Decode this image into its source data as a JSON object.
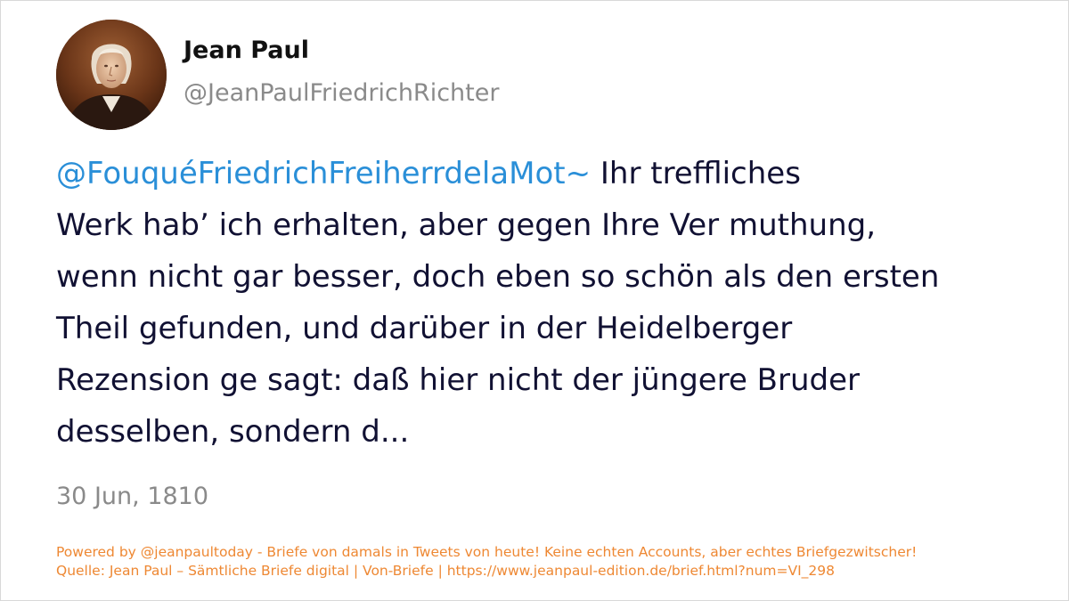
{
  "profile": {
    "display_name": "Jean Paul",
    "handle": "@JeanPaulFriedrichRichter",
    "avatar_icon": "portrait-avatar"
  },
  "tweet": {
    "mention": "@FouquéFriedrichFreiherrdelaMot~",
    "first_line_rest": " Ihr treffliches",
    "lines": [
      "Werk hab’ ich erhalten, aber gegen Ihre Ver muthung,",
      "wenn nicht gar besser, doch eben so schön als den ersten",
      "Theil gefunden, und darüber in der Heidelberger",
      "Rezension ge sagt: daß hier nicht der jüngere Bruder",
      "desselben, sondern d..."
    ],
    "date": "30 Jun, 1810"
  },
  "footer": {
    "powered_by": "Powered by @jeanpaultoday - Briefe von damals in Tweets von heute! Keine echten Accounts, aber echtes Briefgezwitscher!",
    "source": "Quelle: Jean Paul – Sämtliche Briefe digital | Von-Briefe | https://www.jeanpaul-edition.de/brief.html?num=VI_298"
  },
  "colors": {
    "mention": "#2a8fd8",
    "body_text": "#111133",
    "muted": "#8a8a8a",
    "footer": "#ee8833"
  }
}
